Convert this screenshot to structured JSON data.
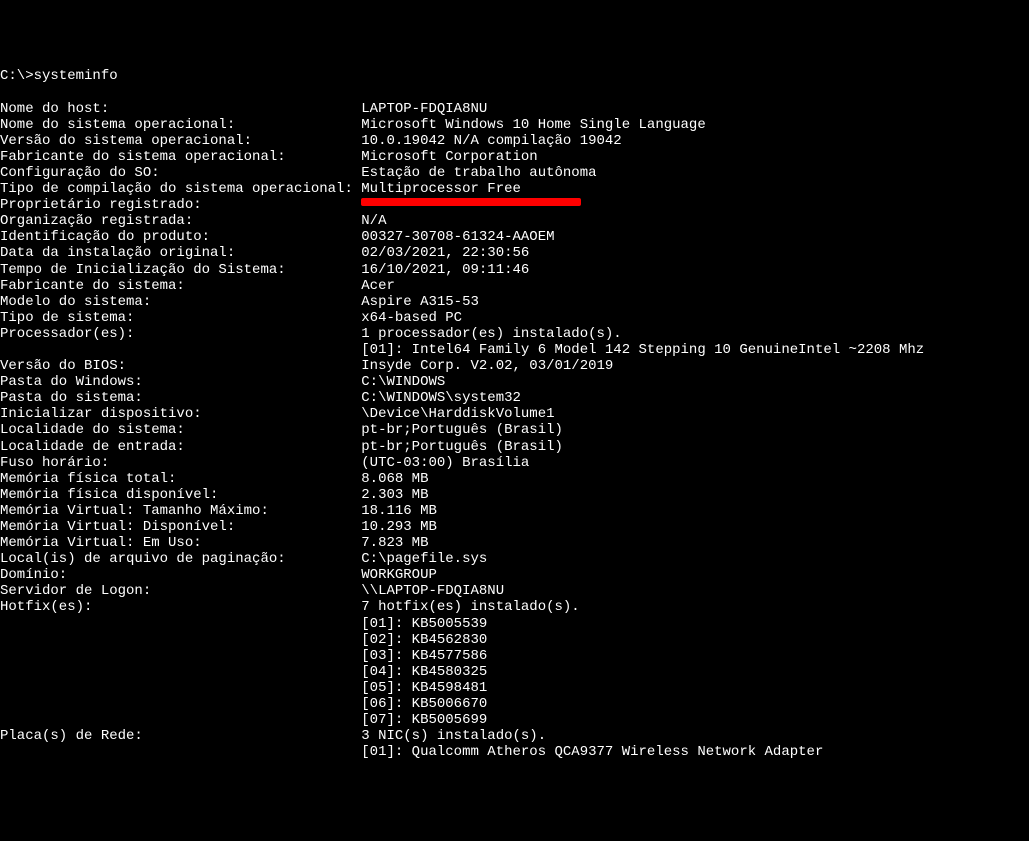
{
  "prompt": "C:\\>systeminfo",
  "blank": "",
  "rows": [
    {
      "label": "Nome do host:",
      "value": "LAPTOP-FDQIA8NU"
    },
    {
      "label": "Nome do sistema operacional:",
      "value": "Microsoft Windows 10 Home Single Language"
    },
    {
      "label": "Versão do sistema operacional:",
      "value": "10.0.19042 N/A compilação 19042"
    },
    {
      "label": "Fabricante do sistema operacional:",
      "value": "Microsoft Corporation"
    },
    {
      "label": "Configuração do SO:",
      "value": "Estação de trabalho autônoma"
    },
    {
      "label": "Tipo de compilação do sistema operacional:",
      "value": "Multiprocessor Free"
    },
    {
      "label": "Proprietário registrado:",
      "value": "",
      "redacted": true
    },
    {
      "label": "Organização registrada:",
      "value": "N/A"
    },
    {
      "label": "Identificação do produto:",
      "value": "00327-30708-61324-AAOEM"
    },
    {
      "label": "Data da instalação original:",
      "value": "02/03/2021, 22:30:56"
    },
    {
      "label": "Tempo de Inicialização do Sistema:",
      "value": "16/10/2021, 09:11:46"
    },
    {
      "label": "Fabricante do sistema:",
      "value": "Acer"
    },
    {
      "label": "Modelo do sistema:",
      "value": "Aspire A315-53"
    },
    {
      "label": "Tipo de sistema:",
      "value": "x64-based PC"
    },
    {
      "label": "Processador(es):",
      "value": "1 processador(es) instalado(s)."
    },
    {
      "label": "",
      "value": "[01]: Intel64 Family 6 Model 142 Stepping 10 GenuineIntel ~2208 Mhz"
    },
    {
      "label": "Versão do BIOS:",
      "value": "Insyde Corp. V2.02, 03/01/2019"
    },
    {
      "label": "Pasta do Windows:",
      "value": "C:\\WINDOWS"
    },
    {
      "label": "Pasta do sistema:",
      "value": "C:\\WINDOWS\\system32"
    },
    {
      "label": "Inicializar dispositivo:",
      "value": "\\Device\\HarddiskVolume1"
    },
    {
      "label": "Localidade do sistema:",
      "value": "pt-br;Português (Brasil)"
    },
    {
      "label": "Localidade de entrada:",
      "value": "pt-br;Português (Brasil)"
    },
    {
      "label": "Fuso horário:",
      "value": "(UTC-03:00) Brasília"
    },
    {
      "label": "Memória física total:",
      "value": "8.068 MB"
    },
    {
      "label": "Memória física disponível:",
      "value": "2.303 MB"
    },
    {
      "label": "Memória Virtual: Tamanho Máximo:",
      "value": "18.116 MB"
    },
    {
      "label": "Memória Virtual: Disponível:",
      "value": "10.293 MB"
    },
    {
      "label": "Memória Virtual: Em Uso:",
      "value": "7.823 MB"
    },
    {
      "label": "Local(is) de arquivo de paginação:",
      "value": "C:\\pagefile.sys"
    },
    {
      "label": "Domínio:",
      "value": "WORKGROUP"
    },
    {
      "label": "Servidor de Logon:",
      "value": "\\\\LAPTOP-FDQIA8NU"
    },
    {
      "label": "Hotfix(es):",
      "value": "7 hotfix(es) instalado(s)."
    },
    {
      "label": "",
      "value": "[01]: KB5005539"
    },
    {
      "label": "",
      "value": "[02]: KB4562830"
    },
    {
      "label": "",
      "value": "[03]: KB4577586"
    },
    {
      "label": "",
      "value": "[04]: KB4580325"
    },
    {
      "label": "",
      "value": "[05]: KB4598481"
    },
    {
      "label": "",
      "value": "[06]: KB5006670"
    },
    {
      "label": "",
      "value": "[07]: KB5005699"
    },
    {
      "label": "Placa(s) de Rede:",
      "value": "3 NIC(s) instalado(s)."
    },
    {
      "label": "",
      "value": "[01]: Qualcomm Atheros QCA9377 Wireless Network Adapter"
    }
  ],
  "label_width": 43
}
